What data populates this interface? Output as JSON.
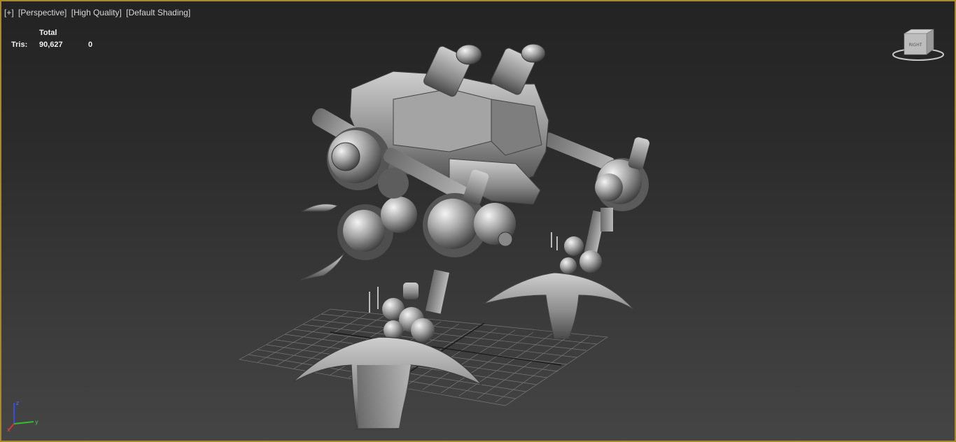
{
  "viewport": {
    "labels": [
      "[+]",
      "[Perspective]",
      "[High Quality]",
      "[Default Shading]"
    ]
  },
  "stats": {
    "header": "Total",
    "tris_label": "Tris:",
    "tris_total": "90,627",
    "tris_selected": "0"
  },
  "viewcube": {
    "face_label": "RIGHT"
  },
  "axes": {
    "x": "x",
    "y": "y",
    "z": "z"
  },
  "colors": {
    "active_border": "#a88a2a",
    "axis_x": "#e03030",
    "axis_y": "#30c030",
    "axis_z": "#3050e0"
  }
}
